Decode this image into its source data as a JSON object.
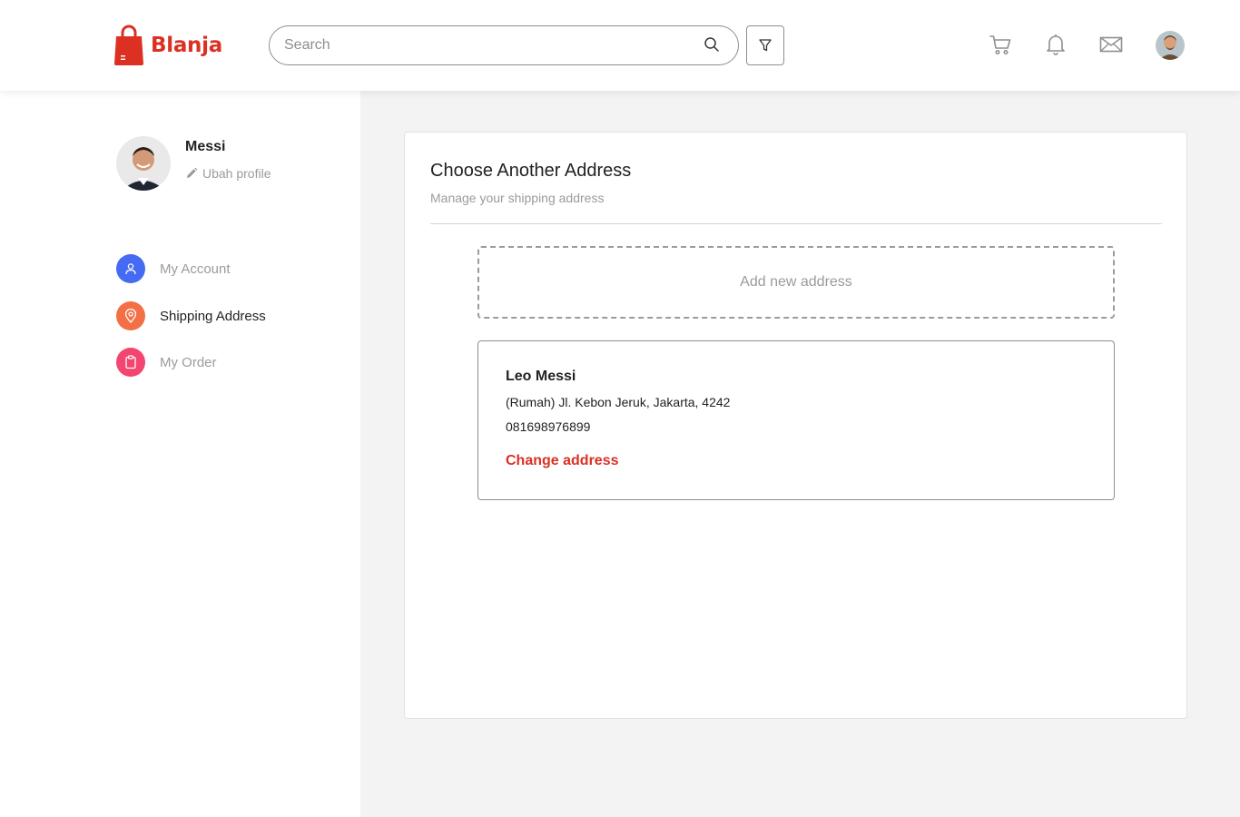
{
  "header": {
    "brand": "Blanja",
    "search_placeholder": "Search",
    "icons": [
      "bag-logo-icon",
      "search-icon",
      "filter-icon",
      "cart-icon",
      "bell-icon",
      "mail-icon",
      "avatar"
    ]
  },
  "sidebar": {
    "user_name": "Messi",
    "edit_label": "Ubah profile",
    "items": [
      {
        "label": "My Account",
        "icon": "user-icon",
        "color": "#456BF3",
        "active": false
      },
      {
        "label": "Shipping Address",
        "icon": "location-pin-icon",
        "color": "#F36F45",
        "active": true
      },
      {
        "label": "My Order",
        "icon": "clipboard-icon",
        "color": "#F3456F",
        "active": false
      }
    ]
  },
  "main": {
    "title": "Choose Another Address",
    "subtitle": "Manage your shipping address",
    "add_label": "Add new address",
    "address": {
      "name": "Leo Messi",
      "line": "(Rumah) Jl. Kebon Jeruk, Jakarta, 4242",
      "phone": "081698976899",
      "change_label": "Change address"
    }
  },
  "colors": {
    "brand": "#DB3022",
    "page_bg": "#F3F3F3"
  }
}
